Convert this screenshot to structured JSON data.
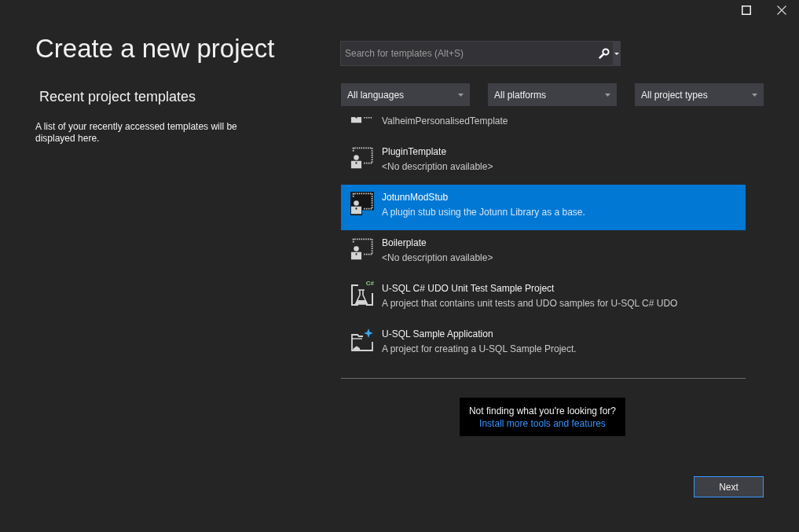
{
  "title": "Create a new project",
  "recent": {
    "heading": "Recent project templates",
    "message": "A list of your recently accessed templates will be displayed here."
  },
  "search": {
    "placeholder": "Search for templates (Alt+S)"
  },
  "filters": [
    {
      "label": "All languages"
    },
    {
      "label": "All platforms"
    },
    {
      "label": "All project types"
    }
  ],
  "templates": [
    {
      "kind": "template",
      "description": "ValheimPersonalisedTemplate",
      "selected": false
    },
    {
      "kind": "template",
      "name": "PluginTemplate",
      "description": "<No description available>",
      "selected": false
    },
    {
      "kind": "template",
      "name": "JotunnModStub",
      "description": "A plugin stub using the Jotunn Library as a base.",
      "selected": true
    },
    {
      "kind": "template",
      "name": "Boilerplate",
      "description": "<No description available>",
      "selected": false
    },
    {
      "kind": "test",
      "name": "U-SQL C# UDO Unit Test Sample Project",
      "description": "A project that contains unit tests and UDO samples for U-SQL C# UDO",
      "badge": "C#",
      "selected": false
    },
    {
      "kind": "application",
      "name": "U-SQL Sample Application",
      "description": "A project for creating a U-SQL Sample Project.",
      "selected": false
    }
  ],
  "help": {
    "prompt": "Not finding what you're looking for?",
    "link": "Install more tools and features"
  },
  "next_button": "Next"
}
